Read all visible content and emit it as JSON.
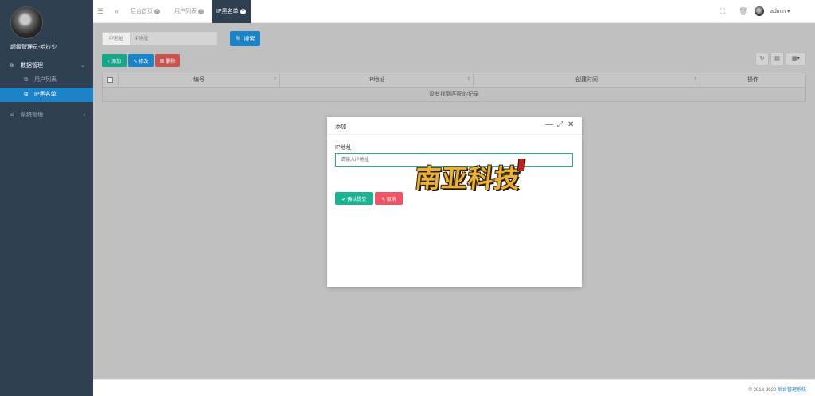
{
  "sidebar": {
    "user_name": "超级管理员-哈拉少",
    "menu": [
      {
        "label": "数据管理",
        "icon": "copy-icon",
        "expanded": true
      },
      {
        "label": "系统管理",
        "icon": "share-icon",
        "expanded": false
      }
    ],
    "submenu": [
      {
        "label": "用户列表",
        "active": false
      },
      {
        "label": "IP黑名单",
        "active": true
      }
    ]
  },
  "topbar": {
    "tabs": [
      {
        "label": "后台首页",
        "active": false
      },
      {
        "label": "用户列表",
        "active": false
      },
      {
        "label": "IP黑名单",
        "active": true
      }
    ],
    "admin_name": "admin"
  },
  "search": {
    "label": "IP地址",
    "placeholder": "IP地址",
    "button": "搜索"
  },
  "toolbar": {
    "add": "添加",
    "edit": "修改",
    "delete": "删除"
  },
  "table": {
    "columns": [
      "编号",
      "IP地址",
      "创建时间",
      "操作"
    ],
    "empty_text": "没有找到匹配的记录"
  },
  "modal": {
    "title": "添加",
    "field_label": "IP地址：",
    "field_placeholder": "请输入IP地址",
    "confirm": "确认提交",
    "cancel": "取消",
    "watermark": "南亚科技"
  },
  "footer": {
    "copyright": "© 2018-2020",
    "link": "后台管理系统"
  },
  "colors": {
    "sidebar_bg": "#2f4050",
    "primary": "#1c84c6",
    "success": "#1ab394",
    "danger": "#ed5565"
  }
}
